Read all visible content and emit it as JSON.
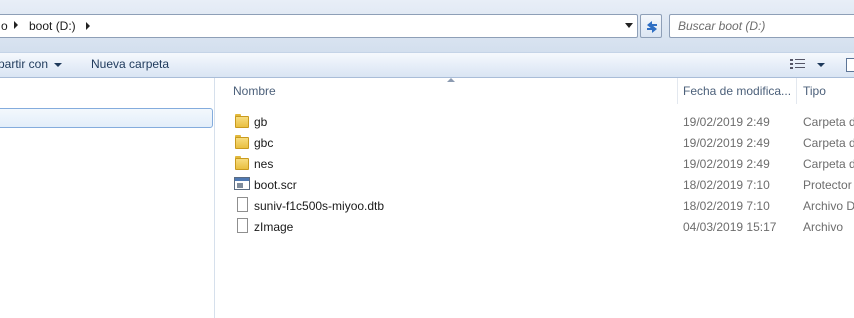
{
  "address_bar": {
    "breadcrumb_partial": "o",
    "current_location": "boot (D:)"
  },
  "search": {
    "placeholder": "Buscar boot (D:)"
  },
  "toolbar": {
    "share_label": "partir con",
    "new_folder_label": "Nueva carpeta"
  },
  "columns": {
    "name": "Nombre",
    "date_modified": "Fecha de modifica...",
    "type": "Tipo"
  },
  "files": [
    {
      "name": "gb",
      "date": "19/02/2019 2:49",
      "type": "Carpeta d",
      "icon": "folder-icon"
    },
    {
      "name": "gbc",
      "date": "19/02/2019 2:49",
      "type": "Carpeta d",
      "icon": "folder-icon"
    },
    {
      "name": "nes",
      "date": "19/02/2019 2:49",
      "type": "Carpeta d",
      "icon": "folder-icon"
    },
    {
      "name": "boot.scr",
      "date": "18/02/2019 7:10",
      "type": "Protector",
      "icon": "screensaver-file-icon"
    },
    {
      "name": "suniv-f1c500s-miyoo.dtb",
      "date": "18/02/2019 7:10",
      "type": "Archivo D",
      "icon": "document-file-icon"
    },
    {
      "name": "zImage",
      "date": "04/03/2019 15:17",
      "type": "Archivo",
      "icon": "document-file-icon"
    }
  ],
  "colors": {
    "header_bg": "#dbe5f1",
    "selection_border": "#84acdd",
    "text_dark": "#1e395b",
    "text_muted": "#6d6d6d"
  }
}
